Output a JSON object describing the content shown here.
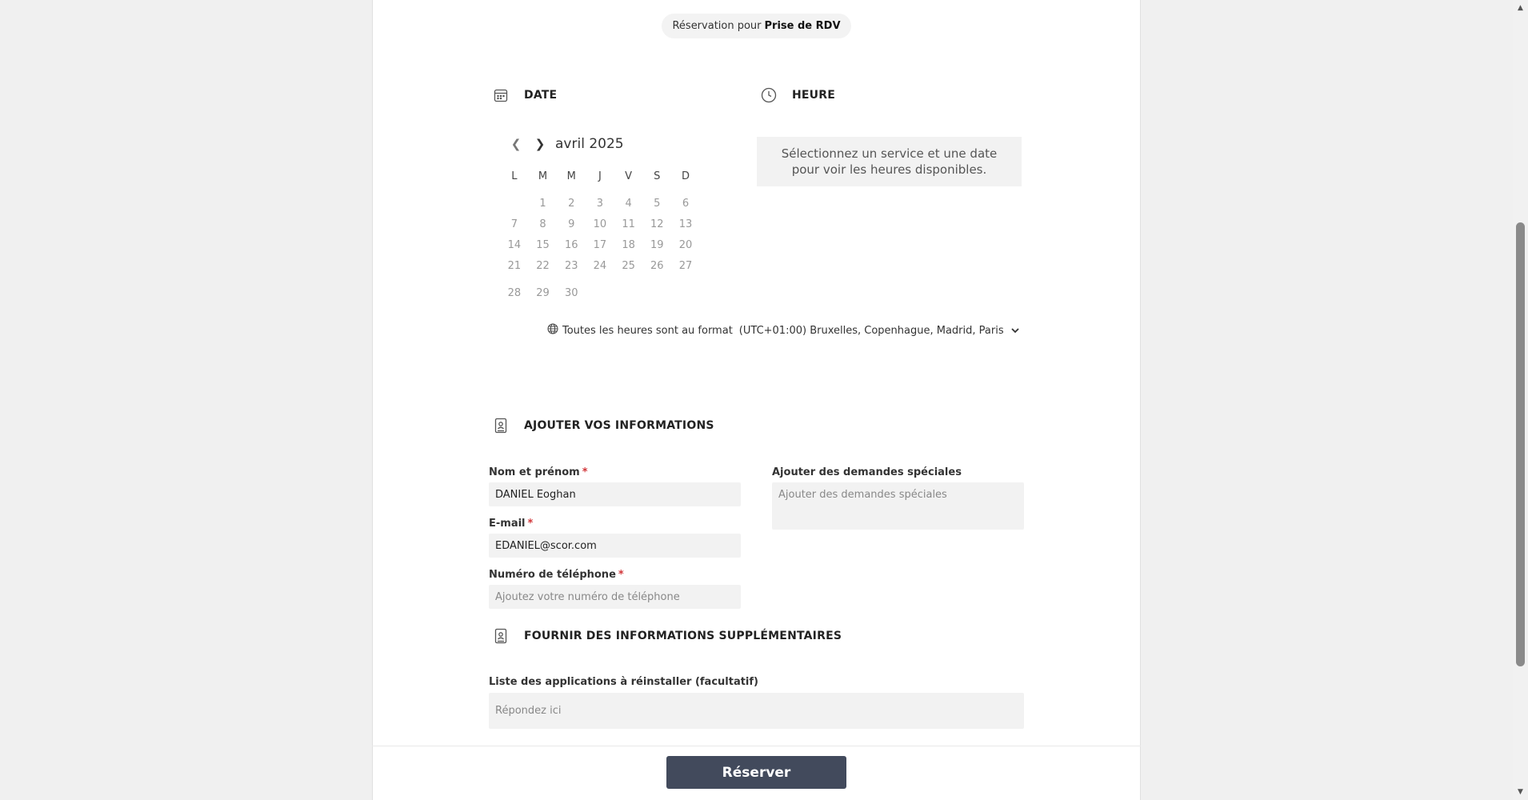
{
  "header": {
    "prefix": "Réservation pour",
    "service": "Prise de RDV"
  },
  "date_section": {
    "title": "DATE",
    "icon": "calendar-icon",
    "month": "avril 2025",
    "prev_icon": "chevron-left-icon",
    "next_icon": "chevron-right-icon",
    "weekdays": [
      "L",
      "M",
      "M",
      "J",
      "V",
      "S",
      "D"
    ],
    "weeks": [
      [
        "",
        "1",
        "2",
        "3",
        "4",
        "5",
        "6"
      ],
      [
        "7",
        "8",
        "9",
        "10",
        "11",
        "12",
        "13"
      ],
      [
        "14",
        "15",
        "16",
        "17",
        "18",
        "19",
        "20"
      ],
      [
        "21",
        "22",
        "23",
        "24",
        "25",
        "26",
        "27"
      ],
      [
        "28",
        "29",
        "30",
        "",
        "",
        "",
        ""
      ]
    ]
  },
  "time_section": {
    "title": "HEURE",
    "icon": "clock-icon",
    "message": "Sélectionnez un service et une date pour voir les heures disponibles."
  },
  "timezone": {
    "icon": "globe-icon",
    "prefix": "Toutes les heures sont au format",
    "value": "(UTC+01:00) Bruxelles, Copenhague, Madrid, Paris"
  },
  "info_section": {
    "title": "AJOUTER VOS INFORMATIONS",
    "icon": "contact-card-icon",
    "name_label": "Nom et prénom",
    "name_value": "DANIEL Eoghan",
    "email_label": "E-mail",
    "email_value": "EDANIEL@scor.com",
    "phone_label": "Numéro de téléphone",
    "phone_placeholder": "Ajoutez votre numéro de téléphone",
    "special_label": "Ajouter des demandes spéciales",
    "special_placeholder": "Ajouter des demandes spéciales",
    "required_mark": "*"
  },
  "extra_section": {
    "title": "FOURNIR DES INFORMATIONS SUPPLÉMENTAIRES",
    "icon": "contact-card-icon",
    "apps_label": "Liste des applications à réinstaller (facultatif)",
    "apps_placeholder": "Répondez ici"
  },
  "submit_label": "Réserver"
}
